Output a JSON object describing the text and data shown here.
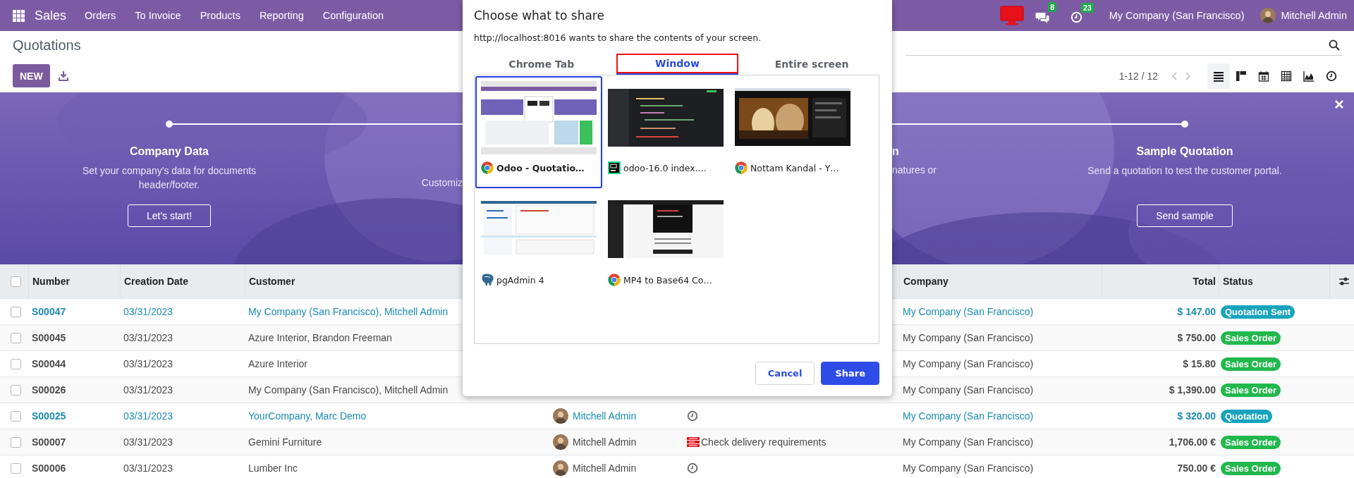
{
  "topbar": {
    "app": "Sales",
    "menu": [
      "Orders",
      "To Invoice",
      "Products",
      "Reporting",
      "Configuration"
    ],
    "messages_badge": "8",
    "activities_badge": "23",
    "company": "My Company (San Francisco)",
    "user": "Mitchell Admin"
  },
  "control_panel": {
    "title": "Quotations",
    "new_button": "NEW",
    "pager": "1-12 / 12",
    "pager_prev": {
      "disabled": true
    },
    "pager_next": {
      "disabled": true
    },
    "views": [
      {
        "kind": "list",
        "selected": true
      },
      {
        "kind": "kanban",
        "selected": false
      },
      {
        "kind": "calendar",
        "selected": false
      },
      {
        "kind": "pivot",
        "selected": false
      },
      {
        "kind": "graph",
        "selected": false
      },
      {
        "kind": "activity",
        "selected": false
      }
    ]
  },
  "banner": {
    "steps": [
      {
        "kind": "full",
        "title": "Company Data",
        "description": "Set your company's data for documents header/footer.",
        "button": "Let's start!"
      },
      {
        "kind": "head",
        "description": "Customiz"
      },
      {
        "kind": "tail",
        "title": "n",
        "description": "natures or"
      },
      {
        "kind": "full",
        "title": "Sample Quotation",
        "description": "Send a quotation to test the customer portal.",
        "button": "Send sample"
      }
    ]
  },
  "table": {
    "select_all": {
      "checked": false
    },
    "columns": [
      {
        "label": "Number"
      },
      {
        "label": "Creation Date"
      },
      {
        "label": "Customer"
      },
      {
        "label": "Company"
      },
      {
        "label": "Total"
      },
      {
        "label": "Status"
      }
    ],
    "rows": [
      {
        "checked": false,
        "highlighted": true,
        "number": "S00047",
        "date": "03/31/2023",
        "customer": "My Company (San Francisco), Mitchell Admin",
        "company": "My Company (San Francisco)",
        "total": "$ 147.00",
        "status": {
          "label": "Quotation Sent",
          "color": "#18a4bd"
        }
      },
      {
        "checked": false,
        "highlighted": false,
        "number": "S00045",
        "date": "03/31/2023",
        "customer": "Azure Interior, Brandon Freeman",
        "company": "My Company (San Francisco)",
        "total": "$ 750.00",
        "status": {
          "label": "Sales Order",
          "color": "#21b84c"
        }
      },
      {
        "checked": false,
        "highlighted": false,
        "number": "S00044",
        "date": "03/31/2023",
        "customer": "Azure Interior",
        "company": "My Company (San Francisco)",
        "total": "$ 15.80",
        "status": {
          "label": "Sales Order",
          "color": "#21b84c"
        }
      },
      {
        "checked": false,
        "highlighted": false,
        "number": "S00026",
        "date": "03/31/2023",
        "customer": "My Company (San Francisco), Mitchell Admin",
        "company": "My Company (San Francisco)",
        "total": "$ 1,390.00",
        "status": {
          "label": "Sales Order",
          "color": "#21b84c"
        }
      },
      {
        "checked": false,
        "highlighted": true,
        "number": "S00025",
        "date": "03/31/2023",
        "customer": "YourCompany, Marc Demo",
        "salesperson": "Mitchell Admin",
        "activity": {
          "kind": "clock"
        },
        "company": "My Company (San Francisco)",
        "total": "$ 320.00",
        "status": {
          "label": "Quotation",
          "color": "#18a4bd"
        }
      },
      {
        "checked": false,
        "highlighted": false,
        "number": "S00007",
        "date": "03/31/2023",
        "customer": "Gemini Furniture",
        "salesperson": "Mitchell Admin",
        "activity": {
          "kind": "task",
          "label": "Check delivery requirements"
        },
        "company": "My Company (San Francisco)",
        "total": "1,706.00 €",
        "status": {
          "label": "Sales Order",
          "color": "#21b84c"
        }
      },
      {
        "checked": false,
        "highlighted": false,
        "number": "S00006",
        "date": "03/31/2023",
        "customer": "Lumber Inc",
        "salesperson": "Mitchell Admin",
        "activity": {
          "kind": "clock"
        },
        "company": "My Company (San Francisco)",
        "total": "750.00 €",
        "status": {
          "label": "Sales Order",
          "color": "#21b84c"
        }
      }
    ]
  },
  "dialog": {
    "title": "Choose what to share",
    "message": "http://localhost:8016 wants to share the contents of your screen.",
    "tabs": [
      {
        "label": "Chrome Tab",
        "selected": false,
        "outlined": false
      },
      {
        "label": "Window",
        "selected": true,
        "outlined": true
      },
      {
        "label": "Entire screen",
        "selected": false,
        "outlined": false
      }
    ],
    "sources": [
      {
        "kind": "browser",
        "name": "Odoo - Quotatio…",
        "selected": true
      },
      {
        "kind": "editor",
        "name": "odoo-16.0  index.…",
        "selected": false
      },
      {
        "kind": "browser",
        "name": "Nottam Kandal - Y…",
        "selected": false
      },
      {
        "kind": "database",
        "name": "pgAdmin 4",
        "selected": false
      },
      {
        "kind": "browser",
        "name": "MP4 to Base64 Co…",
        "selected": false
      }
    ],
    "buttons": [
      {
        "kind": "secondary",
        "label": "Cancel"
      },
      {
        "kind": "primary",
        "label": "Share"
      }
    ]
  }
}
